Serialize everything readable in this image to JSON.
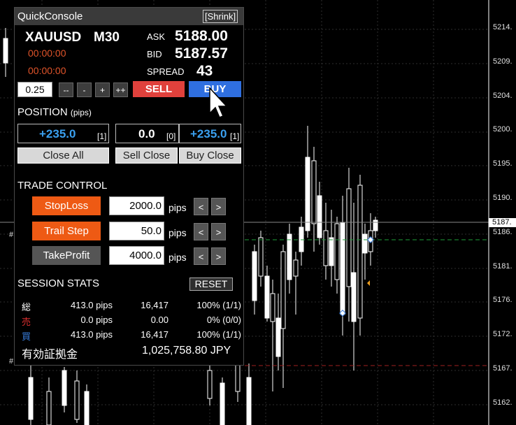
{
  "chart": {
    "price_levels": [
      "5214.",
      "5209.",
      "5204.",
      "5200.",
      "5195.",
      "5190.",
      "5186.",
      "5181.",
      "5176.",
      "5172.",
      "5167.",
      "5162."
    ],
    "current_price_tag": "5187.",
    "hash_marks": [
      "#",
      "#"
    ],
    "colors": {
      "candle_up": "#ffffff",
      "candle_down": "#000000",
      "wick": "#ffffff",
      "grid": "#2e2e2e",
      "ask_line": "#1e9e3a",
      "ref_line": "#a02020"
    }
  },
  "panel": {
    "title": "QuickConsole",
    "shrink_label": "[Shrink]",
    "symbol": "XAUUSD",
    "timeframe": "M30",
    "timer1": "00:00:00",
    "timer2": "00:00:00",
    "ask_label": "ASK",
    "ask": "5188.00",
    "bid_label": "BID",
    "bid": "5187.57",
    "spread_label": "SPREAD",
    "spread": "43",
    "lot": "0.25",
    "step_buttons": [
      "--",
      "-",
      "+",
      "++"
    ],
    "sell_label": "SELL",
    "buy_label": "BUY",
    "position_label": "POSITION",
    "position_unit": "(pips)",
    "pos_total": "+235.0",
    "pos_total_count": "[1]",
    "pos_sell": "0.0",
    "pos_sell_count": "[0]",
    "pos_buy": "+235.0",
    "pos_buy_count": "[1]",
    "close_all": "Close All",
    "sell_close": "Sell Close",
    "buy_close": "Buy Close",
    "trade_control_label": "TRADE CONTROL",
    "stoploss_label": "StopLoss",
    "stoploss_value": "2000.0",
    "trailstep_label": "Trail Step",
    "trailstep_value": "50.0",
    "takeprofit_label": "TakeProfit",
    "takeprofit_value": "4000.0",
    "unit_pips": "pips",
    "arrow_left": "<",
    "arrow_right": ">",
    "session_label": "SESSION STATS",
    "reset_label": "RESET",
    "stats": [
      {
        "label": "総",
        "color": "#ffffff",
        "pips": "413.0 pips",
        "amount": "16,417",
        "rate": "100% (1/1)"
      },
      {
        "label": "売",
        "color": "#e03030",
        "pips": "0.0 pips",
        "amount": "0.00",
        "rate": "0% (0/0)"
      },
      {
        "label": "買",
        "color": "#3a7fe0",
        "pips": "413.0 pips",
        "amount": "16,417",
        "rate": "100% (1/1)"
      }
    ],
    "margin_label": "有効証拠金",
    "margin_value": "1,025,758.80 JPY",
    "colors": {
      "sell": "#e0413c",
      "buy": "#2f6fe0",
      "orange_button": "#ee5a14",
      "gray_button": "#555555",
      "timer": "#e0542a",
      "position_value": "#3aa0f0"
    }
  }
}
